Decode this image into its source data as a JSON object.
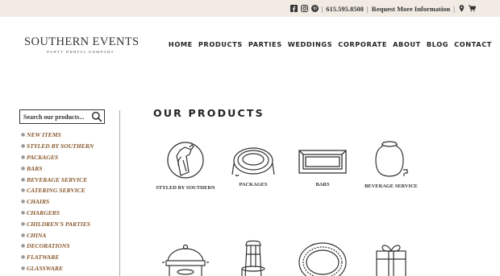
{
  "topbar": {
    "social": [
      "facebook-icon",
      "instagram-icon",
      "pinterest-icon"
    ],
    "phone": "615.595.8508",
    "request_link": "Request More Information",
    "separator": "|",
    "icons": [
      "location-pin-icon",
      "cart-icon"
    ]
  },
  "logo": {
    "title": "SOUTHERN EVENTS",
    "subtitle": "PARTY RENTAL COMPANY"
  },
  "nav": {
    "items": [
      "HOME",
      "PRODUCTS",
      "PARTIES",
      "WEDDINGS",
      "CORPORATE",
      "ABOUT",
      "BLOG",
      "CONTACT"
    ]
  },
  "sidebar": {
    "search_placeholder": "Search our products...",
    "categories": [
      "NEW ITEMS",
      "STYLED BY SOUTHERN",
      "PACKAGES",
      "BARS",
      "BEVERAGE SERVICE",
      "CATERING SERVICE",
      "CHAIRS",
      "CHARGERS",
      "CHILDREN'S PARTIES",
      "CHINA",
      "DECORATIONS",
      "FLATWARE",
      "GLASSWARE"
    ]
  },
  "main": {
    "heading": "OUR PRODUCTS",
    "products": [
      {
        "label": "STYLED BY SOUTHERN",
        "icon": "styled-by-southern-icon"
      },
      {
        "label": "PACKAGES",
        "icon": "packages-icon"
      },
      {
        "label": "BARS",
        "icon": "bars-icon"
      },
      {
        "label": "BEVERAGE SERVICE",
        "icon": "beverage-service-icon"
      },
      {
        "label": "",
        "icon": "chafing-dish-icon"
      },
      {
        "label": "",
        "icon": "chair-icon"
      },
      {
        "label": "",
        "icon": "charger-plate-icon"
      },
      {
        "label": "",
        "icon": "gift-box-icon"
      }
    ]
  },
  "colors": {
    "topbar_bg": "#f2ebe4",
    "category_link": "#8a5a2e",
    "text": "#222222"
  }
}
